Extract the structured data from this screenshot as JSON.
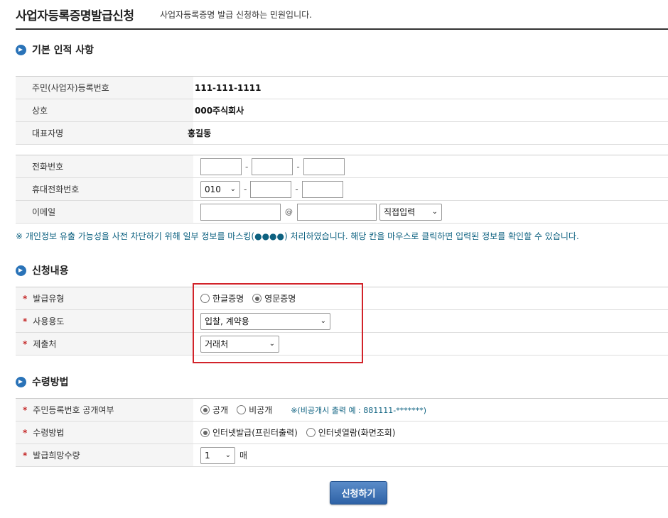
{
  "header": {
    "title": "사업자등록증명발급신청",
    "subtitle": "사업자등록증명 발급 신청하는 민원입니다."
  },
  "basic": {
    "section_title": "기본 인적 사항",
    "rows": [
      {
        "label": "주민(사업자)등록번호",
        "value": "111-111-1111"
      },
      {
        "label": "상호",
        "value": "000주식회사"
      },
      {
        "label": "대표자명",
        "value": "홍길동"
      }
    ]
  },
  "contact": {
    "phone_label": "전화번호",
    "mobile_label": "휴대전화번호",
    "mobile_prefix": "010",
    "email_label": "이메일",
    "email_domain_select": "직접입력",
    "dash": "-",
    "at": "@"
  },
  "notice": "※ 개인정보 유출 가능성을 사전 차단하기 위해 일부 정보를 마스킹(●●●●) 처리하였습니다. 해당 칸을 마우스로 클릭하면 입력된 정보를 확인할 수 있습니다.",
  "application": {
    "section_title": "신청내용",
    "issue_type_label": "발급유형",
    "issue_type_options": [
      "한글증명",
      "영문증명"
    ],
    "issue_type_selected": "영문증명",
    "purpose_label": "사용용도",
    "purpose_value": "입찰, 계약용",
    "submit_to_label": "제출처",
    "submit_to_value": "거래처"
  },
  "receipt": {
    "section_title": "수령방법",
    "disclose_label": "주민등록번호 공개여부",
    "disclose_options": [
      "공개",
      "비공개"
    ],
    "disclose_selected": "공개",
    "disclose_hint": "※(비공개시 출력 예 : 881111-*******)",
    "method_label": "수령방법",
    "method_options": [
      "인터넷발급(프린터출력)",
      "인터넷열람(화면조회)"
    ],
    "method_selected": "인터넷발급(프린터출력)",
    "quantity_label": "발급희망수량",
    "quantity_value": "1",
    "quantity_unit": "매"
  },
  "required_mark": "*",
  "submit_label": "신청하기",
  "colors": {
    "accent_blue": "#2a73b8",
    "highlight_red": "#d2232a",
    "notice_teal": "#0d6180",
    "button_blue": "#2e62a6"
  }
}
